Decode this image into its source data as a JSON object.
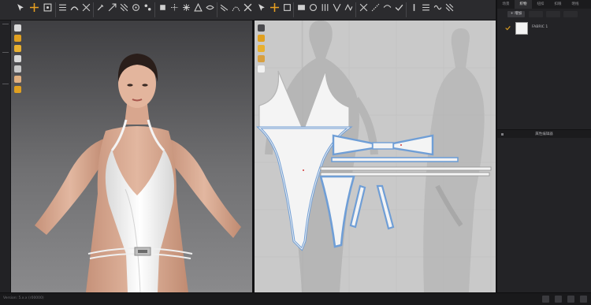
{
  "app": {
    "status_text": "Version: 5.x.x (r00000)"
  },
  "toolbar_left": {
    "icons": [
      "select-move-icon",
      "transform-pattern-icon",
      "edit-point-icon",
      "arrange-icon",
      "simulate-icon",
      "select-mesh-icon",
      "pin-icon",
      "tack-icon",
      "fold-icon",
      "measure-icon",
      "strengthen-icon",
      "shrink-icon",
      "sewing-icon",
      "freeze-icon",
      "deactivate-icon",
      "hide-icon",
      "layer-icon",
      "topstitch-icon",
      "button-icon",
      "zipper-icon",
      "texture-icon",
      "graphic-icon",
      "puckering-icon",
      "avatar-icon"
    ]
  },
  "toolbar_right": {
    "icons": [
      "edit-pattern-icon",
      "transform-icon",
      "polygon-icon",
      "rectangle-icon",
      "circle-icon",
      "internal-line-icon",
      "dart-icon",
      "trace-icon",
      "seam-allowance-icon",
      "segment-sewing-icon",
      "free-sewing-icon",
      "check-sewing-icon",
      "notch-icon",
      "fold-arrange-icon",
      "elastic-icon",
      "pleat-icon"
    ]
  },
  "view3d_tools": [
    "camera-icon",
    "pin-view-icon",
    "texture-view-icon",
    "hand-view-icon",
    "measure-view-icon",
    "avatar-view-icon",
    "color-view-icon"
  ],
  "view2d_tools": [
    "camera-icon",
    "pin-view-icon",
    "texture-view-icon",
    "hand-view-icon",
    "measure-view-icon"
  ],
  "right_panel": {
    "tabs": [
      {
        "label": "场景",
        "active": false
      },
      {
        "label": "织物",
        "active": true
      },
      {
        "label": "纽扣",
        "active": false
      },
      {
        "label": "扣眼",
        "active": false
      },
      {
        "label": "明线",
        "active": false
      }
    ],
    "add_label": "+ 增加",
    "fabric": {
      "name": "FABRIC 1",
      "color": "#f4f4f4",
      "selected": true
    },
    "property_editor_label": "属性编辑器"
  },
  "colors": {
    "accent_check": "#e0a020",
    "pattern_outline": "#6f9ed6",
    "garment": "#f2f2f2"
  }
}
